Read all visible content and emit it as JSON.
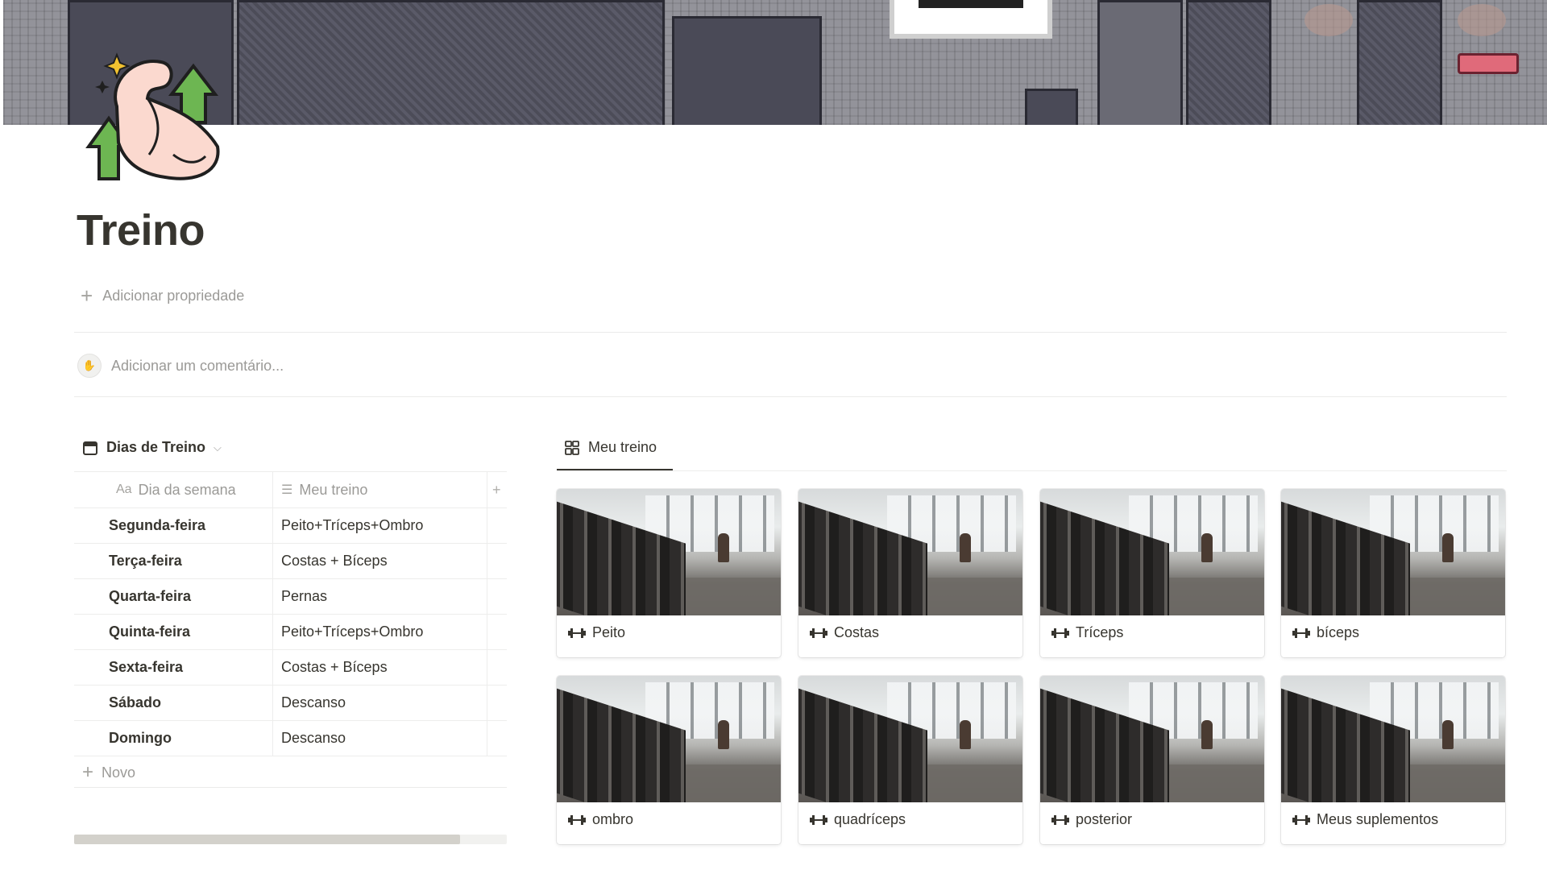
{
  "page": {
    "title": "Treino",
    "add_property_label": "Adicionar propriedade",
    "comment_placeholder": "Adicionar um comentário..."
  },
  "table_view": {
    "name": "Dias de Treino",
    "columns": [
      "Dia da semana",
      "Meu treino"
    ],
    "column_icons": [
      "Aa",
      "text-lines-icon"
    ],
    "rows": [
      {
        "day": "Segunda-feira",
        "workout": "Peito+Tríceps+Ombro"
      },
      {
        "day": "Terça-feira",
        "workout": "Costas + Bíceps"
      },
      {
        "day": "Quarta-feira",
        "workout": "Pernas"
      },
      {
        "day": "Quinta-feira",
        "workout": "Peito+Tríceps+Ombro"
      },
      {
        "day": "Sexta-feira",
        "workout": "Costas + Bíceps"
      },
      {
        "day": "Sábado",
        "workout": "Descanso"
      },
      {
        "day": "Domingo",
        "workout": "Descanso"
      }
    ],
    "new_label": "Novo"
  },
  "gallery_view": {
    "tab_label": "Meu treino",
    "cards": [
      {
        "title": "Peito"
      },
      {
        "title": "Costas"
      },
      {
        "title": "Tríceps"
      },
      {
        "title": "bíceps"
      },
      {
        "title": "ombro"
      },
      {
        "title": "quadríceps"
      },
      {
        "title": "posterior"
      },
      {
        "title": "Meus suplementos"
      }
    ]
  },
  "colors": {
    "text": "#37352f",
    "muted": "#9b9a97",
    "divider": "#ededec"
  }
}
